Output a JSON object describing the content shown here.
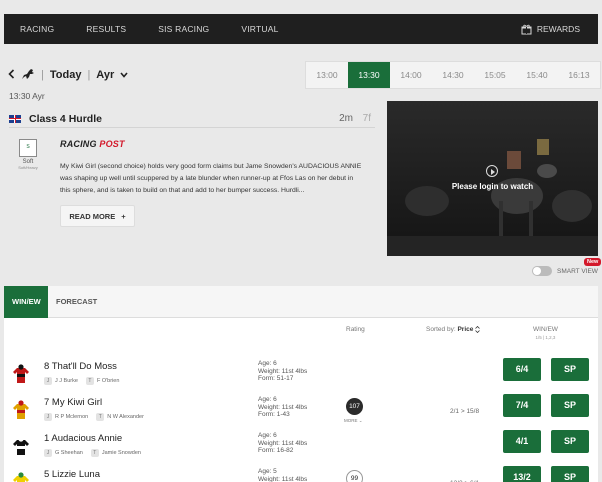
{
  "nav": {
    "items": [
      "RACING",
      "RESULTS",
      "SIS RACING",
      "VIRTUAL"
    ],
    "rewards": "REWARDS",
    "rewards_icon": "gift-icon"
  },
  "header": {
    "back_icon": "chevron-left-icon",
    "horse_icon": "horse-icon",
    "today": "Today",
    "separator": "|",
    "course": "Ayr",
    "dropdown_icon": "chevron-down-icon"
  },
  "times": [
    "13:00",
    "13:30",
    "14:00",
    "14:30",
    "15:05",
    "15:40",
    "16:13"
  ],
  "active_time": "13:30",
  "race": {
    "time_course": "13:30  Ayr",
    "class": "Class 4 Hurdle",
    "distance": "2m",
    "furlongs": "7f",
    "going_icon_text": "S",
    "going": "Soft",
    "going_sub": "Soft/Heavy",
    "rp_logo_racing": "RACING",
    "rp_logo_post": "POST",
    "description": "My Kiwi Girl (second choice) holds very good form claims but Jame Snowden's AUDACIOUS ANNIE was shaping up well until scuppered by a late blunder when runner-up at Ffos Las on her debut in this sphere, and is taken to build on that and add to her bumper success. Hurdli...",
    "read_more": "READ MORE",
    "read_more_icon": "+"
  },
  "video": {
    "login_text": "Please login to watch",
    "play_icon": "play-icon"
  },
  "smart_view": "SMART VIEW",
  "new_badge": "New",
  "market": {
    "tabs": [
      "WIN/EW",
      "FORECAST"
    ],
    "rating_header": "Rating",
    "sorted_by": "Sorted by:",
    "sorted_value": "Price",
    "sort_icon": "sort-icon",
    "winew_header": "WIN/EW",
    "terms": "1/5 | 1,2,3",
    "runners": [
      {
        "name": "8 That'll Do Moss",
        "jockey": "J J Burke",
        "trainer": "F O'brien",
        "age": "Age: 6",
        "weight": "Weight: 11st 4lbs",
        "form": "Form: 51-17",
        "rating": "",
        "rating_style": "none",
        "more": "",
        "hist": "",
        "win": "6/4",
        "sp": "SP",
        "silk": [
          "#c01818",
          "#111111"
        ]
      },
      {
        "name": "7 My Kiwi Girl",
        "jockey": "R P Mclernon",
        "trainer": "N W Alexander",
        "age": "Age: 6",
        "weight": "Weight: 11st 4lbs",
        "form": "Form: 1-43",
        "rating": "107",
        "rating_style": "dark",
        "more": "MORE",
        "hist": "2/1 > 15/8",
        "win": "7/4",
        "sp": "SP",
        "silk": [
          "#e0a000",
          "#c01818"
        ]
      },
      {
        "name": "1 Audacious Annie",
        "jockey": "G Sheehan",
        "trainer": "Jamie Snowden",
        "age": "Age: 6",
        "weight": "Weight: 11st 4lbs",
        "form": "Form: 16-82",
        "rating": "",
        "rating_style": "none",
        "more": "",
        "hist": "",
        "win": "4/1",
        "sp": "SP",
        "silk": [
          "#111111",
          "#ffffff"
        ]
      },
      {
        "name": "5 Lizzie Luna",
        "jockey": "",
        "trainer": "",
        "age": "Age: 5",
        "weight": "Weight: 11st 4lbs",
        "form": "",
        "rating": "99",
        "rating_style": "light",
        "more": "",
        "hist": "13/2 > 6/1",
        "win": "13/2",
        "sp": "SP",
        "silk": [
          "#f0d000",
          "#2c8a3a"
        ]
      }
    ]
  }
}
